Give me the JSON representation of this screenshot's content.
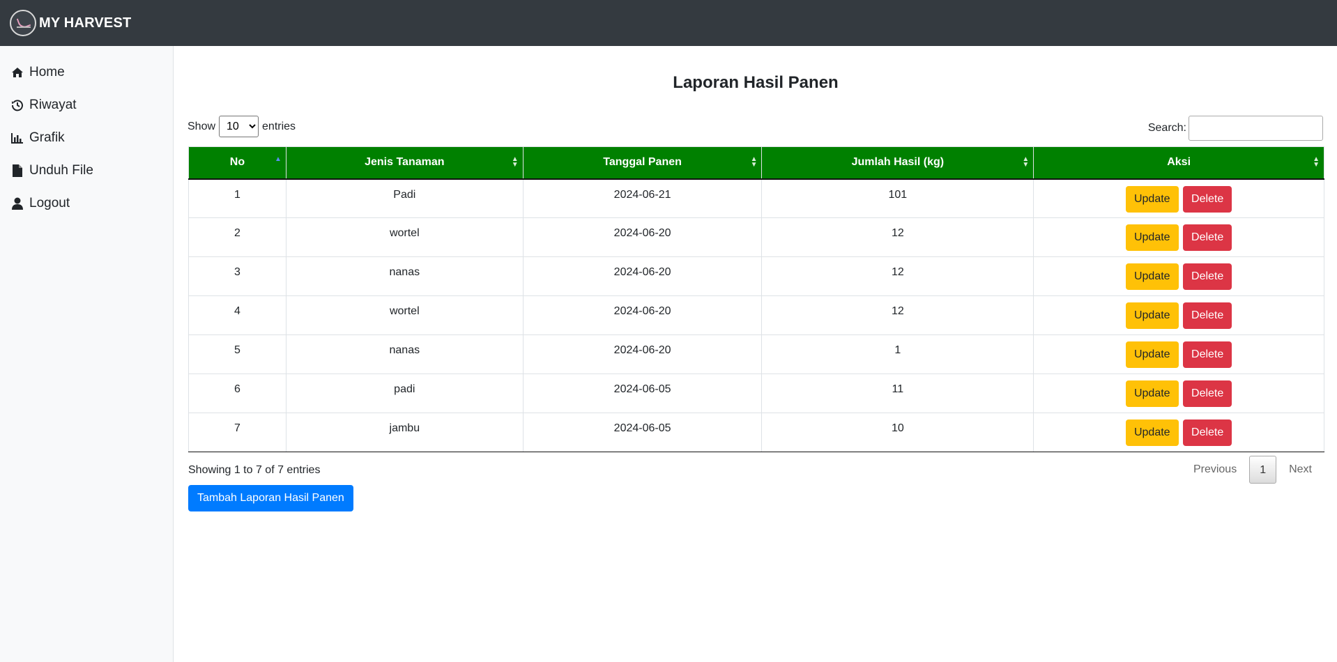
{
  "navbar": {
    "brand": "MY HARVEST"
  },
  "sidebar": {
    "items": [
      {
        "label": "Home",
        "icon": "home-icon"
      },
      {
        "label": "Riwayat",
        "icon": "history-icon"
      },
      {
        "label": "Grafik",
        "icon": "chart-icon"
      },
      {
        "label": "Unduh File",
        "icon": "file-icon"
      },
      {
        "label": "Logout",
        "icon": "user-icon"
      }
    ]
  },
  "main": {
    "title": "Laporan Hasil Panen",
    "length": {
      "show": "Show",
      "value": "10",
      "entries": "entries"
    },
    "search": {
      "label": "Search:",
      "value": ""
    },
    "columns": [
      "No",
      "Jenis Tanaman",
      "Tanggal Panen",
      "Jumlah Hasil (kg)",
      "Aksi"
    ],
    "rows": [
      {
        "no": "1",
        "jenis": "Padi",
        "tanggal": "2024-06-21",
        "jumlah": "101"
      },
      {
        "no": "2",
        "jenis": "wortel",
        "tanggal": "2024-06-20",
        "jumlah": "12"
      },
      {
        "no": "3",
        "jenis": "nanas",
        "tanggal": "2024-06-20",
        "jumlah": "12"
      },
      {
        "no": "4",
        "jenis": "wortel",
        "tanggal": "2024-06-20",
        "jumlah": "12"
      },
      {
        "no": "5",
        "jenis": "nanas",
        "tanggal": "2024-06-20",
        "jumlah": "1"
      },
      {
        "no": "6",
        "jenis": "padi",
        "tanggal": "2024-06-05",
        "jumlah": "11"
      },
      {
        "no": "7",
        "jenis": "jambu",
        "tanggal": "2024-06-05",
        "jumlah": "10"
      }
    ],
    "actions": {
      "update": "Update",
      "delete": "Delete"
    },
    "info": "Showing 1 to 7 of 7 entries",
    "pagination": {
      "previous": "Previous",
      "current": "1",
      "next": "Next"
    },
    "add_button": "Tambah Laporan Hasil Panen"
  },
  "colors": {
    "navbar": "#343a40",
    "header": "#008000",
    "update": "#ffc107",
    "delete": "#dc3545",
    "primary": "#007bff"
  }
}
